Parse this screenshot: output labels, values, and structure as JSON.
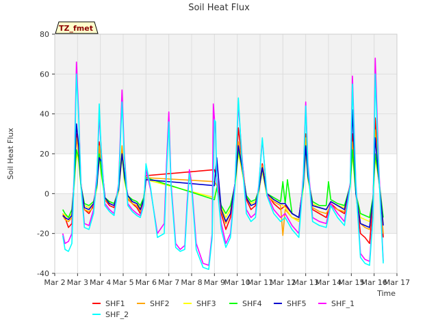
{
  "chart_data": {
    "type": "line",
    "title": "Soil Heat Flux",
    "xlabel": "Time",
    "ylabel": "Soil Heat Flux",
    "annotation": "TZ_fmet",
    "xlim": [
      2,
      17
    ],
    "ylim": [
      -40,
      80
    ],
    "x_ticks": [
      2,
      3,
      4,
      5,
      6,
      7,
      8,
      9,
      10,
      11,
      12,
      13,
      14,
      15,
      16,
      17
    ],
    "x_tick_labels": [
      "Mar 2",
      "Mar 3",
      "Mar 4",
      "Mar 5",
      "Mar 6",
      "Mar 7",
      "Mar 8",
      "Mar 9",
      "Mar 10",
      "Mar 11",
      "Mar 12",
      "Mar 13",
      "Mar 14",
      "Mar 15",
      "Mar 16",
      "Mar 17"
    ],
    "y_ticks": [
      -40,
      -20,
      0,
      20,
      40,
      60,
      80
    ],
    "y_tick_labels": [
      "-40",
      "-20",
      "0",
      "20",
      "40",
      "60",
      "80"
    ],
    "background_bands": [
      [
        -20,
        0
      ],
      [
        40,
        60
      ],
      [
        80,
        100
      ],
      [
        -60,
        -40
      ],
      [
        20,
        40
      ],
      [
        60,
        80
      ]
    ],
    "grid": true,
    "legend_position": "bottom",
    "series": [
      {
        "name": "SHF1",
        "color": "#ff0000",
        "x": [
          2.35,
          2.45,
          2.6,
          2.75,
          2.85,
          2.95,
          3.05,
          3.15,
          3.3,
          3.5,
          3.7,
          3.85,
          3.95,
          4.05,
          4.2,
          4.4,
          4.6,
          4.8,
          4.95,
          5.05,
          5.2,
          5.4,
          5.6,
          5.75,
          5.9,
          6.0,
          9.0,
          9.1,
          9.3,
          9.5,
          9.7,
          9.9,
          10.05,
          10.2,
          10.4,
          10.6,
          10.8,
          10.95,
          11.1,
          11.3,
          11.6,
          11.9,
          12.1,
          12.4,
          12.7,
          12.9,
          13.0,
          13.1,
          13.3,
          13.6,
          13.9,
          14.1,
          14.4,
          14.7,
          14.95,
          15.05,
          15.2,
          15.4,
          15.6,
          15.8,
          15.95,
          16.05,
          16.2,
          16.4
        ],
        "y": [
          -10,
          -12,
          -17,
          -15,
          5,
          30,
          22,
          5,
          -8,
          -10,
          -6,
          5,
          26,
          12,
          -3,
          -6,
          -7,
          2,
          22,
          10,
          -2,
          -5,
          -7,
          -10,
          -4,
          9,
          12,
          8,
          -10,
          -18,
          -12,
          5,
          33,
          18,
          -3,
          -8,
          -6,
          2,
          15,
          0,
          -5,
          -8,
          -6,
          -10,
          -12,
          5,
          30,
          10,
          -8,
          -10,
          -12,
          -5,
          -8,
          -10,
          5,
          30,
          0,
          -20,
          -22,
          -25,
          -5,
          38,
          10,
          -22
        ]
      },
      {
        "name": "SHF2",
        "color": "#ffa500",
        "x": [
          2.35,
          2.45,
          2.6,
          2.75,
          2.85,
          2.95,
          3.05,
          3.15,
          3.3,
          3.5,
          3.7,
          3.85,
          3.95,
          4.05,
          4.2,
          4.4,
          4.6,
          4.8,
          4.95,
          5.05,
          5.2,
          5.4,
          5.6,
          5.75,
          5.9,
          6.0,
          9.0,
          9.1,
          9.3,
          9.5,
          9.7,
          9.9,
          10.05,
          10.2,
          10.4,
          10.6,
          10.8,
          10.95,
          11.1,
          11.3,
          11.6,
          11.9,
          12.0,
          12.1,
          12.4,
          12.7,
          12.9,
          13.0,
          13.1,
          13.3,
          13.6,
          13.9,
          14.1,
          14.4,
          14.7,
          14.95,
          15.05,
          15.2,
          15.4,
          15.6,
          15.8,
          15.95,
          16.05,
          16.2,
          16.4
        ],
        "y": [
          -11,
          -13,
          -14,
          -12,
          5,
          28,
          20,
          4,
          -8,
          -9,
          -7,
          4,
          24,
          11,
          -3,
          -5,
          -6,
          1,
          24,
          9,
          -3,
          -5,
          -6,
          -9,
          -5,
          8,
          6,
          4,
          -9,
          -15,
          -10,
          4,
          26,
          16,
          -2,
          -6,
          -5,
          1,
          14,
          -1,
          -4,
          -6,
          -21,
          -8,
          -12,
          -13,
          4,
          28,
          9,
          -7,
          -9,
          -10,
          -6,
          -8,
          -9,
          4,
          26,
          0,
          -15,
          -17,
          -18,
          -4,
          32,
          9,
          -20
        ]
      },
      {
        "name": "SHF3",
        "color": "#ffff00",
        "x": [
          2.35,
          2.45,
          2.6,
          2.75,
          2.85,
          2.95,
          3.05,
          3.15,
          3.3,
          3.5,
          3.7,
          3.85,
          3.95,
          4.05,
          4.2,
          4.4,
          4.6,
          4.8,
          4.95,
          5.05,
          5.2,
          5.4,
          5.6,
          5.75,
          5.9,
          6.0,
          9.0,
          9.1,
          9.3,
          9.5,
          9.7,
          9.9,
          10.05,
          10.2,
          10.4,
          10.6,
          10.8,
          10.95,
          11.1,
          11.3,
          11.6,
          11.9,
          12.1,
          12.4,
          12.7,
          12.9,
          13.0,
          13.1,
          13.3,
          13.6,
          13.9,
          14.1,
          14.4,
          14.7,
          14.95,
          15.05,
          15.2,
          15.4,
          15.6,
          15.8,
          15.95,
          16.05,
          16.2,
          16.4
        ],
        "y": [
          -10,
          -11,
          -12,
          -10,
          4,
          20,
          16,
          3,
          -6,
          -7,
          -5,
          3,
          18,
          9,
          -2,
          -4,
          -5,
          1,
          18,
          7,
          -2,
          -4,
          -5,
          -7,
          -3,
          7,
          -2,
          2,
          -7,
          -12,
          -8,
          3,
          20,
          12,
          -2,
          -5,
          -4,
          1,
          11,
          -1,
          -3,
          -5,
          -7,
          -12,
          -14,
          3,
          22,
          7,
          -5,
          -7,
          -8,
          -4,
          -6,
          -7,
          3,
          20,
          0,
          -12,
          -13,
          -14,
          -3,
          18,
          7,
          -15
        ]
      },
      {
        "name": "SHF4",
        "color": "#00ff00",
        "x": [
          2.35,
          2.45,
          2.6,
          2.75,
          2.85,
          2.95,
          3.05,
          3.15,
          3.3,
          3.5,
          3.7,
          3.85,
          3.95,
          4.05,
          4.2,
          4.4,
          4.6,
          4.8,
          4.95,
          5.05,
          5.2,
          5.4,
          5.6,
          5.75,
          5.9,
          6.0,
          9.0,
          9.1,
          9.3,
          9.5,
          9.7,
          9.9,
          10.05,
          10.2,
          10.4,
          10.6,
          10.8,
          10.95,
          11.1,
          11.3,
          11.6,
          11.9,
          12.0,
          12.1,
          12.2,
          12.4,
          12.7,
          12.9,
          13.0,
          13.1,
          13.3,
          13.6,
          13.9,
          14.0,
          14.1,
          14.4,
          14.7,
          14.95,
          15.05,
          15.2,
          15.4,
          15.6,
          15.8,
          15.95,
          16.05,
          16.2,
          16.4
        ],
        "y": [
          -8,
          -10,
          -12,
          -8,
          5,
          22,
          18,
          4,
          -5,
          -6,
          -4,
          4,
          20,
          10,
          -2,
          -4,
          -5,
          2,
          20,
          8,
          -1,
          -3,
          -4,
          -6,
          -2,
          8,
          -3,
          3,
          -6,
          -10,
          -6,
          4,
          22,
          14,
          -1,
          -4,
          -3,
          2,
          13,
          0,
          -2,
          -4,
          6,
          -5,
          7,
          -10,
          -12,
          4,
          24,
          8,
          -4,
          -6,
          -6,
          6,
          -3,
          -5,
          -6,
          4,
          22,
          0,
          -10,
          -11,
          -12,
          -2,
          20,
          8,
          -12
        ]
      },
      {
        "name": "SHF5",
        "color": "#0000cd",
        "x": [
          2.35,
          2.45,
          2.6,
          2.75,
          2.85,
          2.95,
          3.05,
          3.15,
          3.3,
          3.5,
          3.7,
          3.85,
          3.95,
          4.05,
          4.2,
          4.4,
          4.6,
          4.8,
          4.95,
          5.05,
          5.2,
          5.4,
          5.6,
          5.75,
          5.9,
          6.0,
          9.0,
          9.1,
          9.3,
          9.5,
          9.7,
          9.9,
          10.05,
          10.2,
          10.4,
          10.6,
          10.8,
          10.95,
          11.1,
          11.3,
          11.6,
          11.9,
          12.1,
          12.4,
          12.7,
          12.9,
          13.0,
          13.1,
          13.3,
          13.6,
          13.9,
          14.1,
          14.4,
          14.7,
          14.95,
          15.05,
          15.2,
          15.4,
          15.6,
          15.8,
          15.95,
          16.05,
          16.2,
          16.4
        ],
        "y": [
          -11,
          -12,
          -13,
          -11,
          6,
          35,
          24,
          4,
          -7,
          -8,
          -5,
          5,
          18,
          16,
          -2,
          -5,
          -6,
          2,
          20,
          10,
          -1,
          -4,
          -5,
          -8,
          -3,
          7,
          4,
          18,
          -8,
          -14,
          -10,
          5,
          24,
          14,
          -2,
          -6,
          -5,
          2,
          13,
          0,
          -3,
          -5,
          -5,
          -10,
          -12,
          5,
          24,
          9,
          -6,
          -7,
          -8,
          -4,
          -6,
          -8,
          4,
          42,
          0,
          -15,
          -16,
          -17,
          -3,
          28,
          8,
          -16
        ]
      },
      {
        "name": "SHF_1",
        "color": "#ff00ff",
        "x": [
          2.35,
          2.45,
          2.6,
          2.75,
          2.85,
          2.95,
          3.05,
          3.15,
          3.3,
          3.5,
          3.7,
          3.85,
          3.95,
          4.05,
          4.2,
          4.4,
          4.6,
          4.8,
          4.95,
          5.05,
          5.2,
          5.4,
          5.6,
          5.75,
          5.9,
          6.0,
          6.2,
          6.5,
          6.8,
          6.9,
          7.0,
          7.1,
          7.3,
          7.5,
          7.7,
          7.8,
          7.9,
          8.0,
          8.2,
          8.5,
          8.75,
          8.9,
          8.95,
          9.05,
          9.1,
          9.3,
          9.5,
          9.7,
          9.9,
          10.05,
          10.2,
          10.4,
          10.6,
          10.8,
          10.95,
          11.1,
          11.3,
          11.6,
          11.9,
          12.1,
          12.4,
          12.7,
          12.9,
          13.0,
          13.1,
          13.3,
          13.6,
          13.9,
          14.1,
          14.4,
          14.7,
          14.95,
          15.05,
          15.2,
          15.4,
          15.6,
          15.8,
          15.95,
          16.05,
          16.2,
          16.4
        ],
        "y": [
          -20,
          -25,
          -24,
          -20,
          10,
          66,
          40,
          5,
          -15,
          -16,
          -8,
          10,
          39,
          20,
          -5,
          -8,
          -10,
          5,
          52,
          20,
          -5,
          -8,
          -10,
          -11,
          -5,
          12,
          2,
          -20,
          -15,
          15,
          41,
          5,
          -25,
          -28,
          -26,
          -5,
          12,
          5,
          -25,
          -35,
          -36,
          -20,
          45,
          30,
          8,
          -15,
          -25,
          -20,
          5,
          45,
          20,
          -8,
          -12,
          -10,
          5,
          27,
          0,
          -8,
          -12,
          -10,
          -16,
          -20,
          10,
          46,
          15,
          -12,
          -14,
          -15,
          -5,
          -10,
          -14,
          5,
          59,
          5,
          -30,
          -33,
          -34,
          -10,
          68,
          15,
          -34
        ]
      },
      {
        "name": "SHF_2",
        "color": "#00ffff",
        "x": [
          2.35,
          2.45,
          2.6,
          2.75,
          2.85,
          2.95,
          3.05,
          3.15,
          3.3,
          3.5,
          3.7,
          3.85,
          3.95,
          4.05,
          4.2,
          4.4,
          4.6,
          4.8,
          4.95,
          5.05,
          5.2,
          5.4,
          5.6,
          5.75,
          5.9,
          6.0,
          6.2,
          6.5,
          6.8,
          6.9,
          7.0,
          7.1,
          7.3,
          7.5,
          7.7,
          7.8,
          7.9,
          8.0,
          8.2,
          8.5,
          8.75,
          8.9,
          9.0,
          9.05,
          9.1,
          9.3,
          9.5,
          9.7,
          9.9,
          10.05,
          10.2,
          10.4,
          10.6,
          10.8,
          10.95,
          11.1,
          11.3,
          11.6,
          11.9,
          12.1,
          12.4,
          12.7,
          12.9,
          13.0,
          13.1,
          13.3,
          13.6,
          13.9,
          14.1,
          14.4,
          14.7,
          14.95,
          15.05,
          15.2,
          15.4,
          15.6,
          15.8,
          15.95,
          16.05,
          16.2,
          16.4
        ],
        "y": [
          -21,
          -28,
          -29,
          -25,
          8,
          60,
          38,
          4,
          -17,
          -18,
          -10,
          8,
          45,
          18,
          -6,
          -9,
          -11,
          4,
          46,
          18,
          -6,
          -9,
          -11,
          -12,
          -6,
          15,
          3,
          -22,
          -20,
          10,
          36,
          3,
          -27,
          -29,
          -28,
          -8,
          10,
          3,
          -28,
          -37,
          -38,
          -22,
          37,
          36,
          6,
          -18,
          -27,
          -22,
          3,
          48,
          18,
          -10,
          -14,
          -12,
          4,
          28,
          -1,
          -10,
          -14,
          -12,
          -18,
          -22,
          8,
          44,
          13,
          -14,
          -16,
          -17,
          -6,
          -12,
          -16,
          4,
          55,
          4,
          -32,
          -35,
          -36,
          -12,
          60,
          12,
          -35
        ]
      }
    ]
  }
}
